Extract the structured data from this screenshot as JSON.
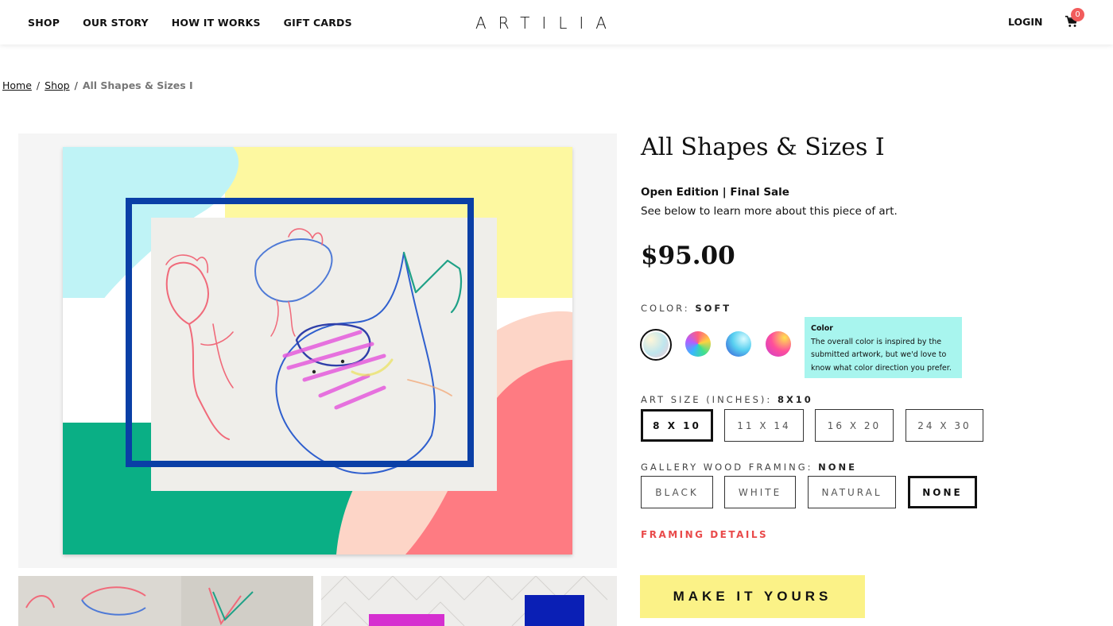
{
  "header": {
    "nav": [
      "SHOP",
      "OUR STORY",
      "HOW IT WORKS",
      "GIFT CARDS"
    ],
    "logo": "ARTILIA",
    "login": "LOGIN",
    "cart_count": "0"
  },
  "breadcrumb": {
    "home": "Home",
    "shop": "Shop",
    "current": "All Shapes & Sizes I",
    "separator": "/"
  },
  "product": {
    "title": "All Shapes & Sizes I",
    "edition": "Open Edition | Final Sale",
    "description": "See below to learn more about this piece of art.",
    "price": "$95.00"
  },
  "color": {
    "label": "COLOR:",
    "selected": "SOFT",
    "tooltip_title": "Color",
    "tooltip_text": "The overall color is inspired by the submitted artwork, but we'd love to know what color direction you prefer."
  },
  "size": {
    "label": "ART SIZE (INCHES):",
    "selected": "8X10",
    "options": [
      "8 X 10",
      "11 X 14",
      "16 X 20",
      "24 X 30"
    ]
  },
  "framing": {
    "label": "GALLERY WOOD FRAMING:",
    "selected": "NONE",
    "options": [
      "BLACK",
      "WHITE",
      "NATURAL",
      "NONE"
    ],
    "details_link": "FRAMING DETAILS"
  },
  "cta": "MAKE IT YOURS",
  "colors": {
    "accent_red": "#e94a4a",
    "cta_yellow": "#fbf287",
    "tooltip_bg": "#a8f5ee",
    "badge": "#f25c5c"
  }
}
